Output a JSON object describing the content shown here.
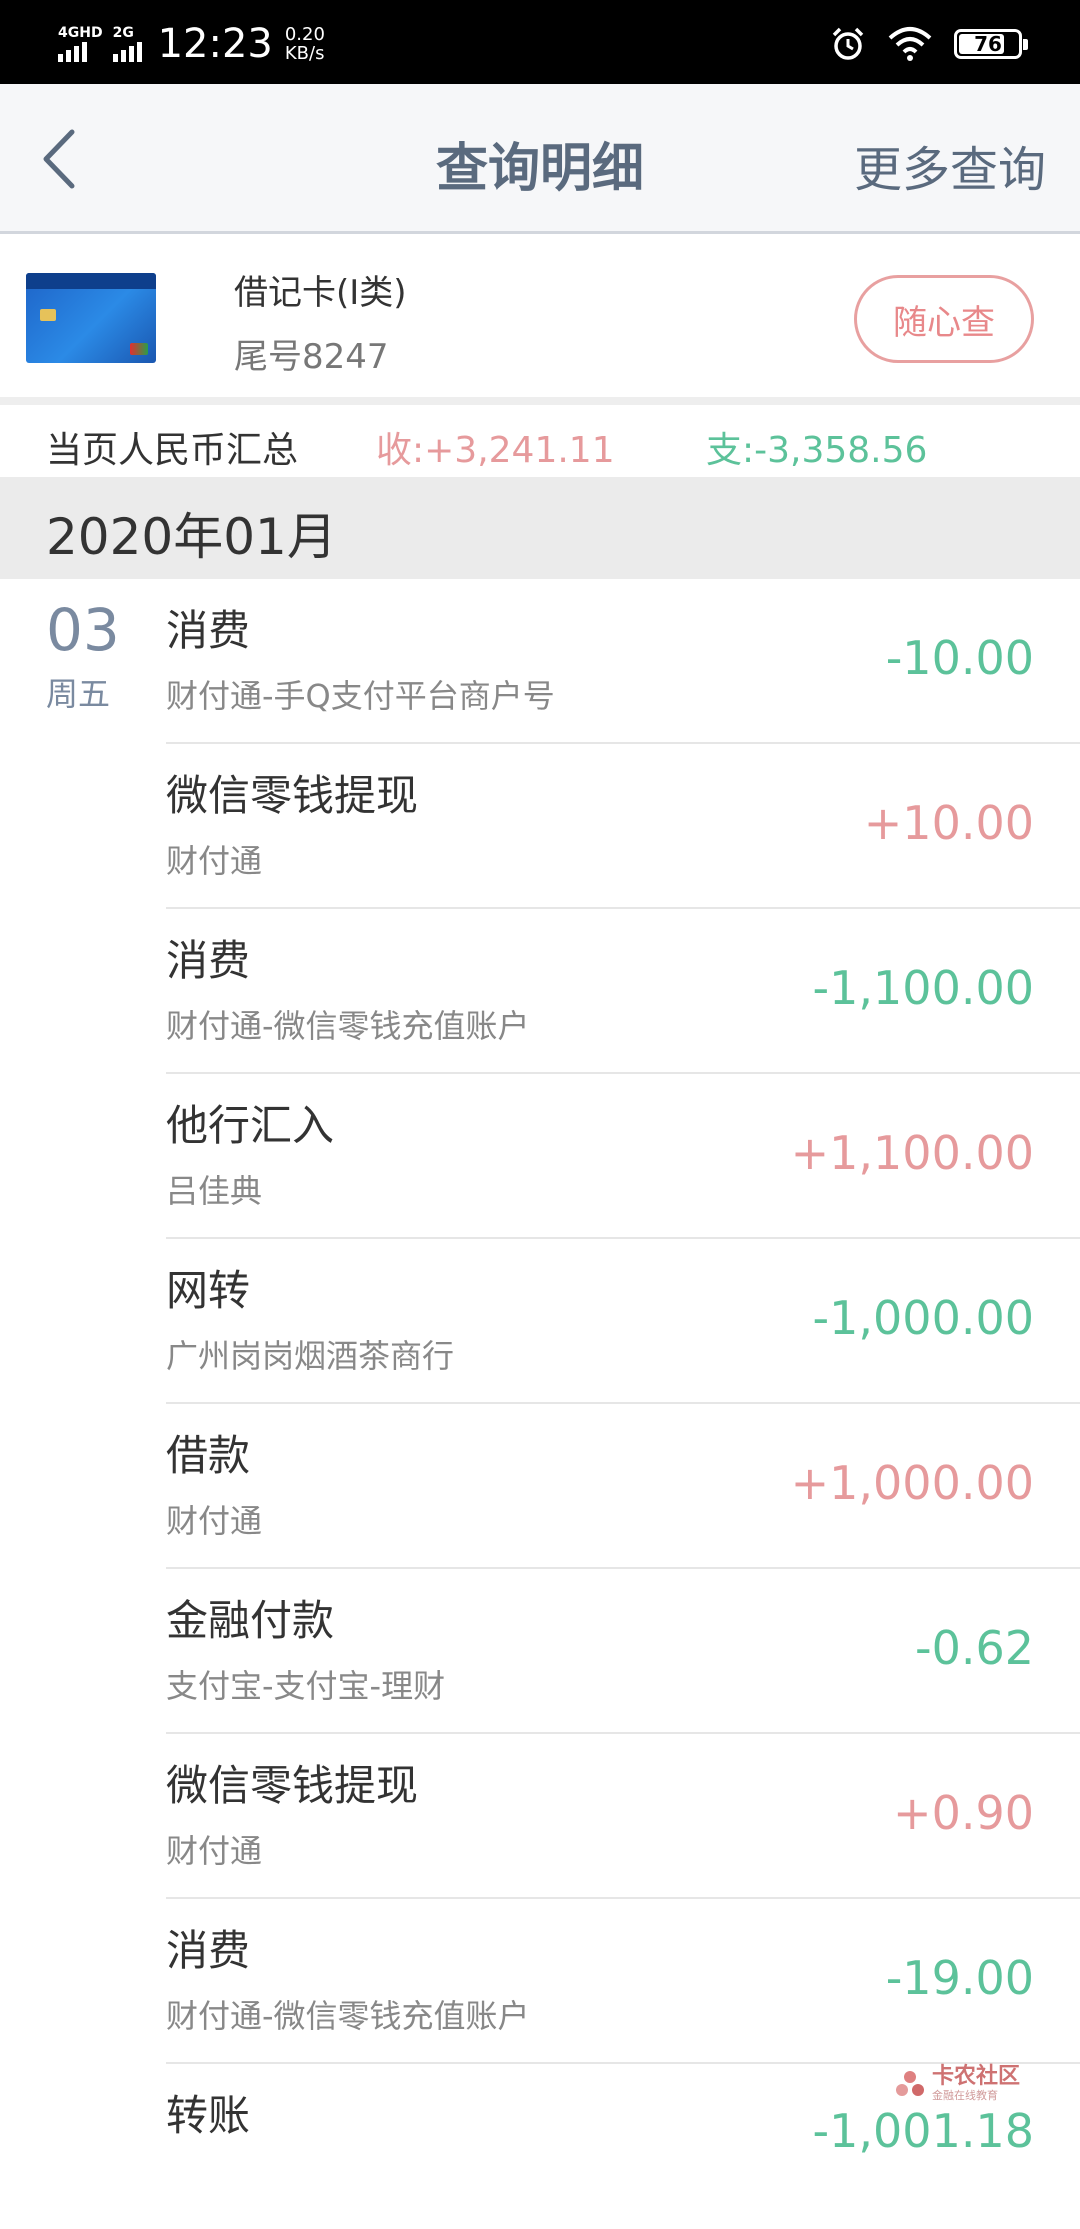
{
  "status_bar": {
    "sim1_label": "4GHD",
    "sim2_label": "2G",
    "time": "12:23",
    "speed_value": "0.20",
    "speed_unit": "KB/s",
    "battery": "76"
  },
  "header": {
    "title": "查询明细",
    "more": "更多查询"
  },
  "card": {
    "type": "借记卡(Ⅰ类)",
    "tail": "尾号8247",
    "query_button": "随心查"
  },
  "summary": {
    "label": "当页人民币汇总",
    "income": "收:+3,241.11",
    "expense": "支:-3,358.56"
  },
  "month": "2020年01月",
  "date": {
    "day": "03",
    "weekday": "周五"
  },
  "transactions": [
    {
      "title": "消费",
      "sub": "财付通-手Q支付平台商户号",
      "amount": "-10.00",
      "type": "neg"
    },
    {
      "title": "微信零钱提现",
      "sub": "财付通",
      "amount": "+10.00",
      "type": "pos"
    },
    {
      "title": "消费",
      "sub": "财付通-微信零钱充值账户",
      "amount": "-1,100.00",
      "type": "neg"
    },
    {
      "title": "他行汇入",
      "sub": "吕佳典",
      "amount": "+1,100.00",
      "type": "pos"
    },
    {
      "title": "网转",
      "sub": "广州岗岗烟酒茶商行",
      "amount": "-1,000.00",
      "type": "neg"
    },
    {
      "title": "借款",
      "sub": "财付通",
      "amount": "+1,000.00",
      "type": "pos"
    },
    {
      "title": "金融付款",
      "sub": "支付宝-支付宝-理财",
      "amount": "-0.62",
      "type": "neg"
    },
    {
      "title": "微信零钱提现",
      "sub": "财付通",
      "amount": "+0.90",
      "type": "pos"
    },
    {
      "title": "消费",
      "sub": "财付通-微信零钱充值账户",
      "amount": "-19.00",
      "type": "neg"
    },
    {
      "title": "转账",
      "sub": "",
      "amount": "-1,001.18",
      "type": "neg"
    }
  ],
  "watermark": {
    "main": "卡农社区",
    "sub": "金融在线教育"
  },
  "colors": {
    "income": "#e69a9c",
    "expense": "#5cc29a",
    "header_text": "#5a6a7e"
  },
  "icons": {
    "back": "chevron-left-icon",
    "alarm": "alarm-icon",
    "wifi": "wifi-icon",
    "battery": "battery-icon",
    "card": "bank-card-icon"
  }
}
